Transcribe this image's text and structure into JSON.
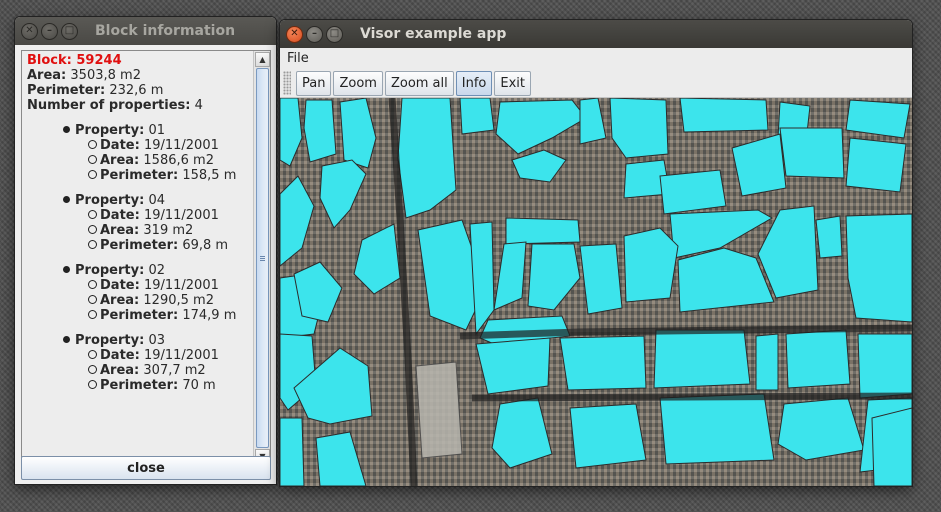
{
  "info_window": {
    "title": "Block information",
    "block_label": "Block:",
    "block_id": "59244",
    "area_label": "Area:",
    "area_value": "3503,8 m2",
    "perimeter_label": "Perimeter:",
    "perimeter_value": "232,6 m",
    "num_properties_label": "Number of properties:",
    "num_properties_value": "4",
    "properties": [
      {
        "property_label": "Property:",
        "id": "01",
        "date_label": "Date:",
        "date": "19/11/2001",
        "area_label": "Area:",
        "area": "1586,6 m2",
        "perimeter_label": "Perimeter:",
        "perimeter": "158,5 m"
      },
      {
        "property_label": "Property:",
        "id": "04",
        "date_label": "Date:",
        "date": "19/11/2001",
        "area_label": "Area:",
        "area": "319 m2",
        "perimeter_label": "Perimeter:",
        "perimeter": "69,8 m"
      },
      {
        "property_label": "Property:",
        "id": "02",
        "date_label": "Date:",
        "date": "19/11/2001",
        "area_label": "Area:",
        "area": "1290,5 m2",
        "perimeter_label": "Perimeter:",
        "perimeter": "174,9 m"
      },
      {
        "property_label": "Property:",
        "id": "03",
        "date_label": "Date:",
        "date": "19/11/2001",
        "area_label": "Area:",
        "area": "307,7 m2",
        "perimeter_label": "Perimeter:",
        "perimeter": "70 m"
      }
    ],
    "close_label": "close"
  },
  "visor_window": {
    "title": "Visor example app",
    "menu": [
      "File"
    ],
    "toolbar": [
      "Pan",
      "Zoom",
      "Zoom all",
      "Info",
      "Exit"
    ],
    "selected_tool": "Info"
  },
  "colors": {
    "block_fill": "#3ce4ec",
    "block_id_color": "#e01010"
  }
}
